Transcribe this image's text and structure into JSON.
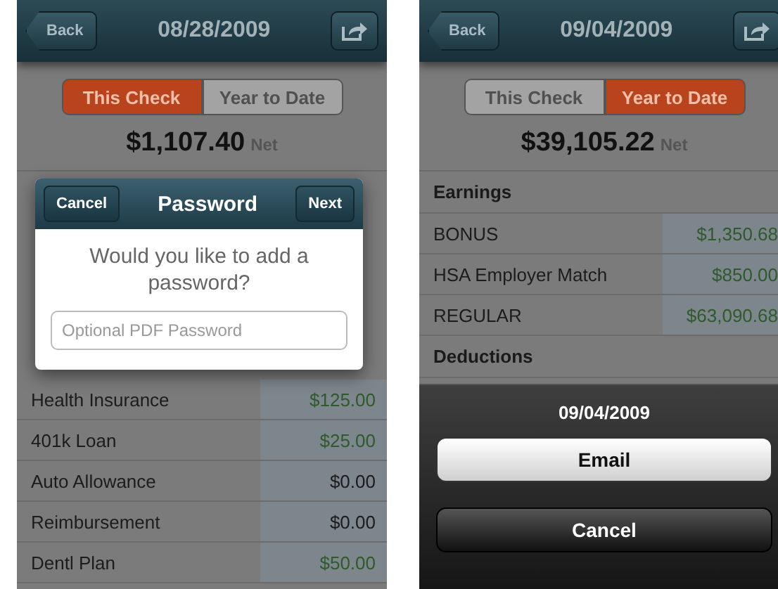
{
  "phones": [
    {
      "nav": {
        "back": "Back",
        "title": "08/28/2009"
      },
      "segments": [
        {
          "label": "This Check",
          "selected": true
        },
        {
          "label": "Year to Date",
          "selected": false
        }
      ],
      "net": {
        "amount": "$1,107.40",
        "label": "Net"
      },
      "sections": [
        {
          "rows": [
            {
              "label": "Health Insurance",
              "value": "$125.00",
              "color": "#2f5a2c"
            },
            {
              "label": "401k Loan",
              "value": "$25.00",
              "color": "#2f5a2c"
            },
            {
              "label": "Auto Allowance",
              "value": "$0.00",
              "color": "#1c1c1c"
            },
            {
              "label": "Reimbursement",
              "value": "$0.00",
              "color": "#1c1c1c"
            },
            {
              "label": "Dentl Plan",
              "value": "$50.00",
              "color": "#2f5a2c"
            }
          ]
        }
      ],
      "overlay": {
        "kind": "password",
        "cancel": "Cancel",
        "title": "Password",
        "next": "Next",
        "question": "Would you like to add a password?",
        "field": {
          "placeholder": "Optional PDF Password"
        }
      }
    },
    {
      "nav": {
        "back": "Back",
        "title": "09/04/2009"
      },
      "segments": [
        {
          "label": "This Check",
          "selected": false
        },
        {
          "label": "Year to Date",
          "selected": true
        }
      ],
      "net": {
        "amount": "$39,105.22",
        "label": "Net"
      },
      "sections": [
        {
          "header": "Earnings",
          "rows": [
            {
              "label": "BONUS",
              "value": "$1,350.68",
              "color": "#2f5a2c"
            },
            {
              "label": "HSA Employer Match",
              "value": "$850.00",
              "color": "#2f5a2c"
            },
            {
              "label": "REGULAR",
              "value": "$63,090.68",
              "color": "#2f5a2c"
            }
          ]
        },
        {
          "header": "Deductions"
        }
      ],
      "overlay": {
        "kind": "action_sheet",
        "title": "09/04/2009",
        "buttons": [
          {
            "label": "Email",
            "kind": "default"
          },
          {
            "label": "Cancel",
            "kind": "cancel"
          }
        ]
      }
    }
  ]
}
